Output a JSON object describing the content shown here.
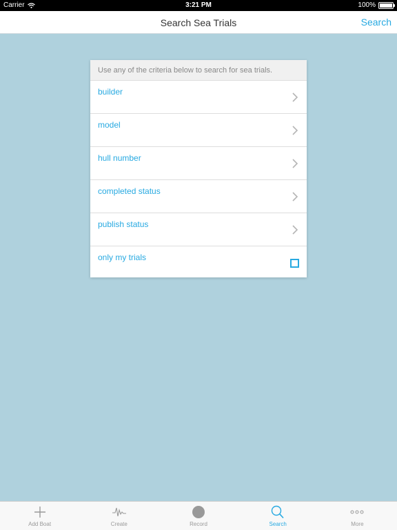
{
  "status": {
    "carrier": "Carrier",
    "time": "3:21 PM",
    "battery": "100%",
    "battery_level": 1.0
  },
  "nav": {
    "title": "Search Sea Trials",
    "action": "Search"
  },
  "panel": {
    "hint": "Use any of the criteria below to search for sea trials.",
    "rows": [
      {
        "label": "builder"
      },
      {
        "label": "model"
      },
      {
        "label": "hull number"
      },
      {
        "label": "completed status"
      },
      {
        "label": "publish status"
      },
      {
        "label": "only my trials"
      }
    ]
  },
  "tabs": [
    {
      "label": "Add Boat",
      "icon": "plus-icon"
    },
    {
      "label": "Create",
      "icon": "waveform-icon"
    },
    {
      "label": "Record",
      "icon": "record-icon"
    },
    {
      "label": "Search",
      "icon": "search-icon",
      "active": true
    },
    {
      "label": "More",
      "icon": "more-icon"
    }
  ],
  "colors": {
    "accent": "#27a9e1",
    "background": "#afd1dd"
  }
}
